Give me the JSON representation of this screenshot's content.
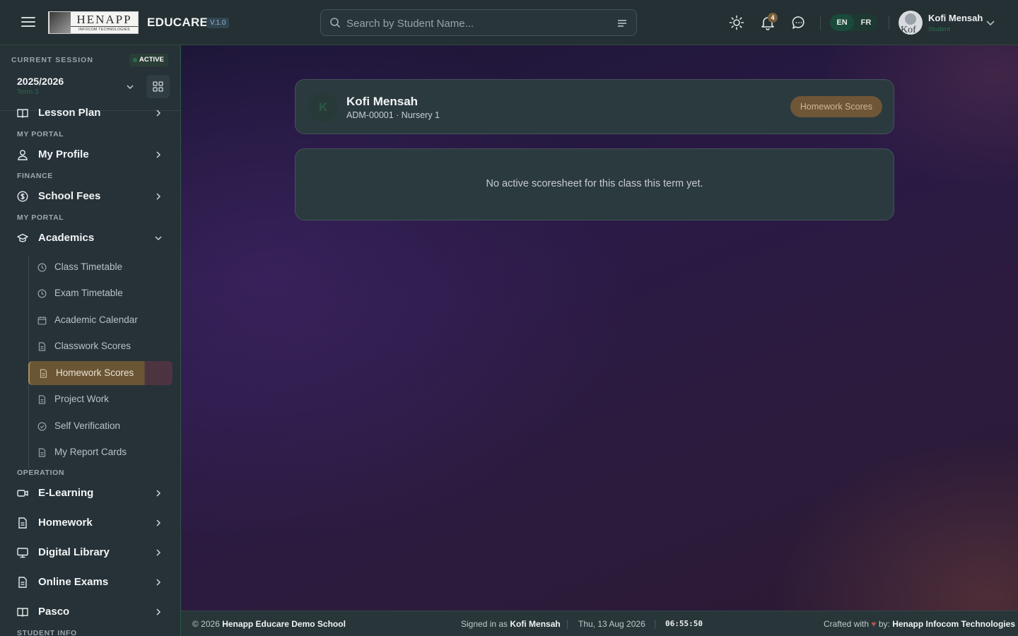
{
  "header": {
    "logo_text": "HENAPP",
    "logo_subtext": "INFOCOM TECHNOLOGIES",
    "app_name": "EDUCARE",
    "version": "V.1.0",
    "search_placeholder": "Search by Student Name...",
    "notification_count": "4",
    "languages": [
      "EN",
      "FR"
    ],
    "active_language": "EN",
    "user_name": "Kofi Mensah",
    "user_role": "Student",
    "avatar_text": "Kof"
  },
  "sidebar": {
    "session_label": "CURRENT SESSION",
    "session_status": "ACTIVE",
    "session_year": "2025/2026",
    "session_term": "Term 3",
    "items": [
      {
        "label": "Lesson Plan",
        "icon": "book-icon"
      },
      {
        "section": "MY PORTAL"
      },
      {
        "label": "My Profile",
        "icon": "user-icon"
      },
      {
        "section": "FINANCE"
      },
      {
        "label": "School Fees",
        "icon": "dollar-icon"
      },
      {
        "section": "MY PORTAL"
      },
      {
        "label": "Academics",
        "icon": "graduation-cap-icon",
        "expanded": true
      }
    ],
    "sections": [
      "MY PORTAL",
      "FINANCE",
      "MY PORTAL",
      "OPERATION",
      "STUDENT INFO"
    ],
    "lesson_plan": "Lesson Plan",
    "my_profile": "My Profile",
    "school_fees": "School Fees",
    "academics": "Academics",
    "academics_sub": [
      "Class Timetable",
      "Exam Timetable",
      "Academic Calendar",
      "Classwork Scores",
      "Homework Scores",
      "Project Work",
      "Self Verification",
      "My Report Cards"
    ],
    "active_subitem": "Homework Scores",
    "operation_items": [
      "E-Learning",
      "Homework",
      "Digital Library",
      "Online Exams",
      "Pasco"
    ]
  },
  "main": {
    "student_initial": "K",
    "student_name": "Kofi Mensah",
    "student_meta": "ADM-00001 · Nursery 1",
    "page_pill": "Homework Scores",
    "empty_message": "No active scoresheet for this class this term yet."
  },
  "footer": {
    "copyright_prefix": "© 2026",
    "school_name": "Henapp Educare Demo School",
    "signed_in_prefix": "Signed in as",
    "signed_in_user": "Kofi Mensah",
    "date": "Thu, 13 Aug 2026",
    "time": "06:55:50",
    "crafted_prefix": "Crafted with",
    "heart": "♥",
    "crafted_by": "by:",
    "company": "Henapp Infocom Technologies"
  },
  "colors": {
    "accent_green": "#2d6c4a",
    "active_item_gold": "#6a5535",
    "card_bg": "#2b3a3f"
  }
}
